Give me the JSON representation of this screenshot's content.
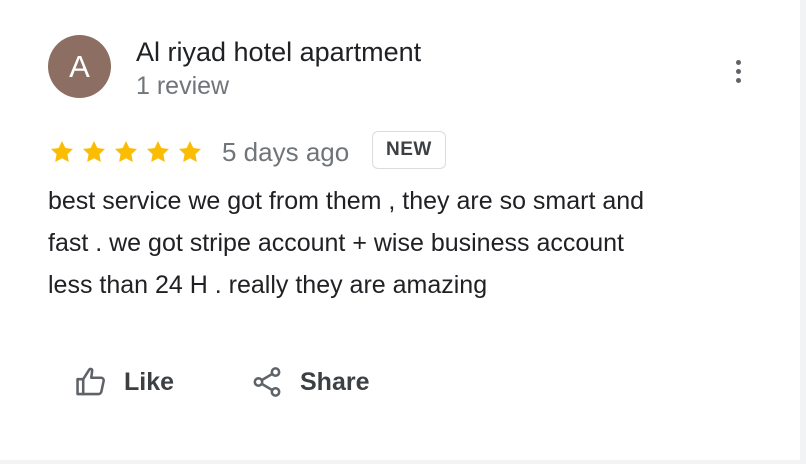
{
  "colors": {
    "avatar_bg": "#8d6e63",
    "star": "#fbbc04",
    "text_primary": "#202124",
    "text_secondary": "#70757a",
    "icon": "#5f6368"
  },
  "reviewer": {
    "avatar_initial": "A",
    "name": "Al riyad hotel apartment",
    "review_count": "1 review"
  },
  "menu": {
    "icon": "more-vert-icon"
  },
  "review": {
    "rating": 5,
    "rating_max": 5,
    "time": "5 days ago",
    "badge": "NEW",
    "text_lines": [
      "best service we got from them , they are so smart and",
      "fast . we got stripe account + wise business account",
      "less than 24 H . really they are amazing"
    ]
  },
  "actions": {
    "like": {
      "label": "Like",
      "icon": "thumb-up-icon"
    },
    "share": {
      "label": "Share",
      "icon": "share-icon"
    }
  }
}
